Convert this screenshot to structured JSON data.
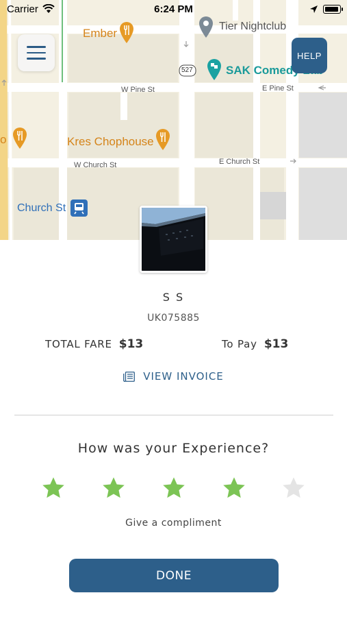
{
  "status_bar": {
    "carrier": "Carrier",
    "time": "6:24 PM"
  },
  "map": {
    "pois": {
      "ember": "Ember",
      "tier_nightclub": "Tier Nightclub",
      "sak_comedy": "SAK Comedy Lab",
      "kres_chophouse": "Kres Chophouse",
      "church_st": "Church St",
      "partial_left": "o"
    },
    "streets": {
      "w_pine": "W Pine St",
      "e_pine": "E Pine St",
      "w_church": "W Church St",
      "e_church": "E Church St"
    },
    "route_shield": "527"
  },
  "menu": {
    "icon": "hamburger-menu-icon"
  },
  "help": {
    "label": "HELP"
  },
  "trip": {
    "driver_name": "S S",
    "vehicle_number": "UK075885",
    "total_fare_label": "TOTAL FARE",
    "total_fare_value": "$13",
    "to_pay_label": "To Pay",
    "to_pay_value": "$13",
    "invoice_label": "VIEW INVOICE"
  },
  "rating": {
    "title": "How was your Experience?",
    "value": 4,
    "max": 5,
    "compliment_label": "Give a compliment",
    "filled_color": "#7cc455",
    "empty_color": "#e4e4e4"
  },
  "actions": {
    "done_label": "DONE"
  },
  "colors": {
    "brand": "#2d5f8a",
    "poi_orange": "#d5841a",
    "poi_teal": "#1a9a9a"
  }
}
